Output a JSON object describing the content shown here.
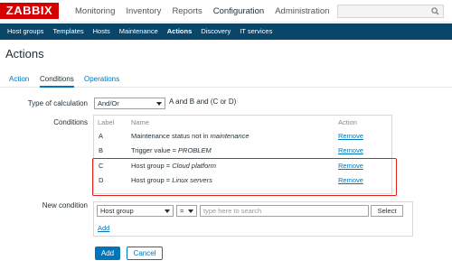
{
  "brand": {
    "logo_text": "ZABBIX",
    "color": "#d40000"
  },
  "top_nav": [
    "Monitoring",
    "Inventory",
    "Reports",
    "Configuration",
    "Administration"
  ],
  "top_nav_active": "Configuration",
  "sub_nav": [
    "Host groups",
    "Templates",
    "Hosts",
    "Maintenance",
    "Actions",
    "Discovery",
    "IT services"
  ],
  "sub_nav_active": "Actions",
  "page_title": "Actions",
  "tabs": [
    "Action",
    "Conditions",
    "Operations"
  ],
  "tabs_active": "Conditions",
  "form": {
    "calc_label": "Type of calculation",
    "calc_value": "And/Or",
    "calc_formula": "A and B and (C or D)",
    "conditions_label": "Conditions",
    "headers": {
      "label": "Label",
      "name": "Name",
      "action": "Action"
    },
    "conditions": [
      {
        "label": "A",
        "name_prefix": "Maintenance status not in ",
        "name_value": "maintenance",
        "action": "Remove"
      },
      {
        "label": "B",
        "name_prefix": "Trigger value = ",
        "name_value": "PROBLEM",
        "action": "Remove"
      },
      {
        "label": "C",
        "name_prefix": "Host group = ",
        "name_value": "Cloud platform",
        "action": "Remove"
      },
      {
        "label": "D",
        "name_prefix": "Host group = ",
        "name_value": "Linux servers",
        "action": "Remove"
      }
    ],
    "new_condition_label": "New condition",
    "new_condition_type": "Host group",
    "new_condition_operator": "=",
    "new_condition_placeholder": "type here to search",
    "select_button": "Select",
    "add_link": "Add"
  },
  "buttons": {
    "add": "Add",
    "cancel": "Cancel"
  },
  "colors": {
    "accent": "#0275b8",
    "subnav_bg": "#0a466a",
    "highlight": "#d9241c"
  }
}
